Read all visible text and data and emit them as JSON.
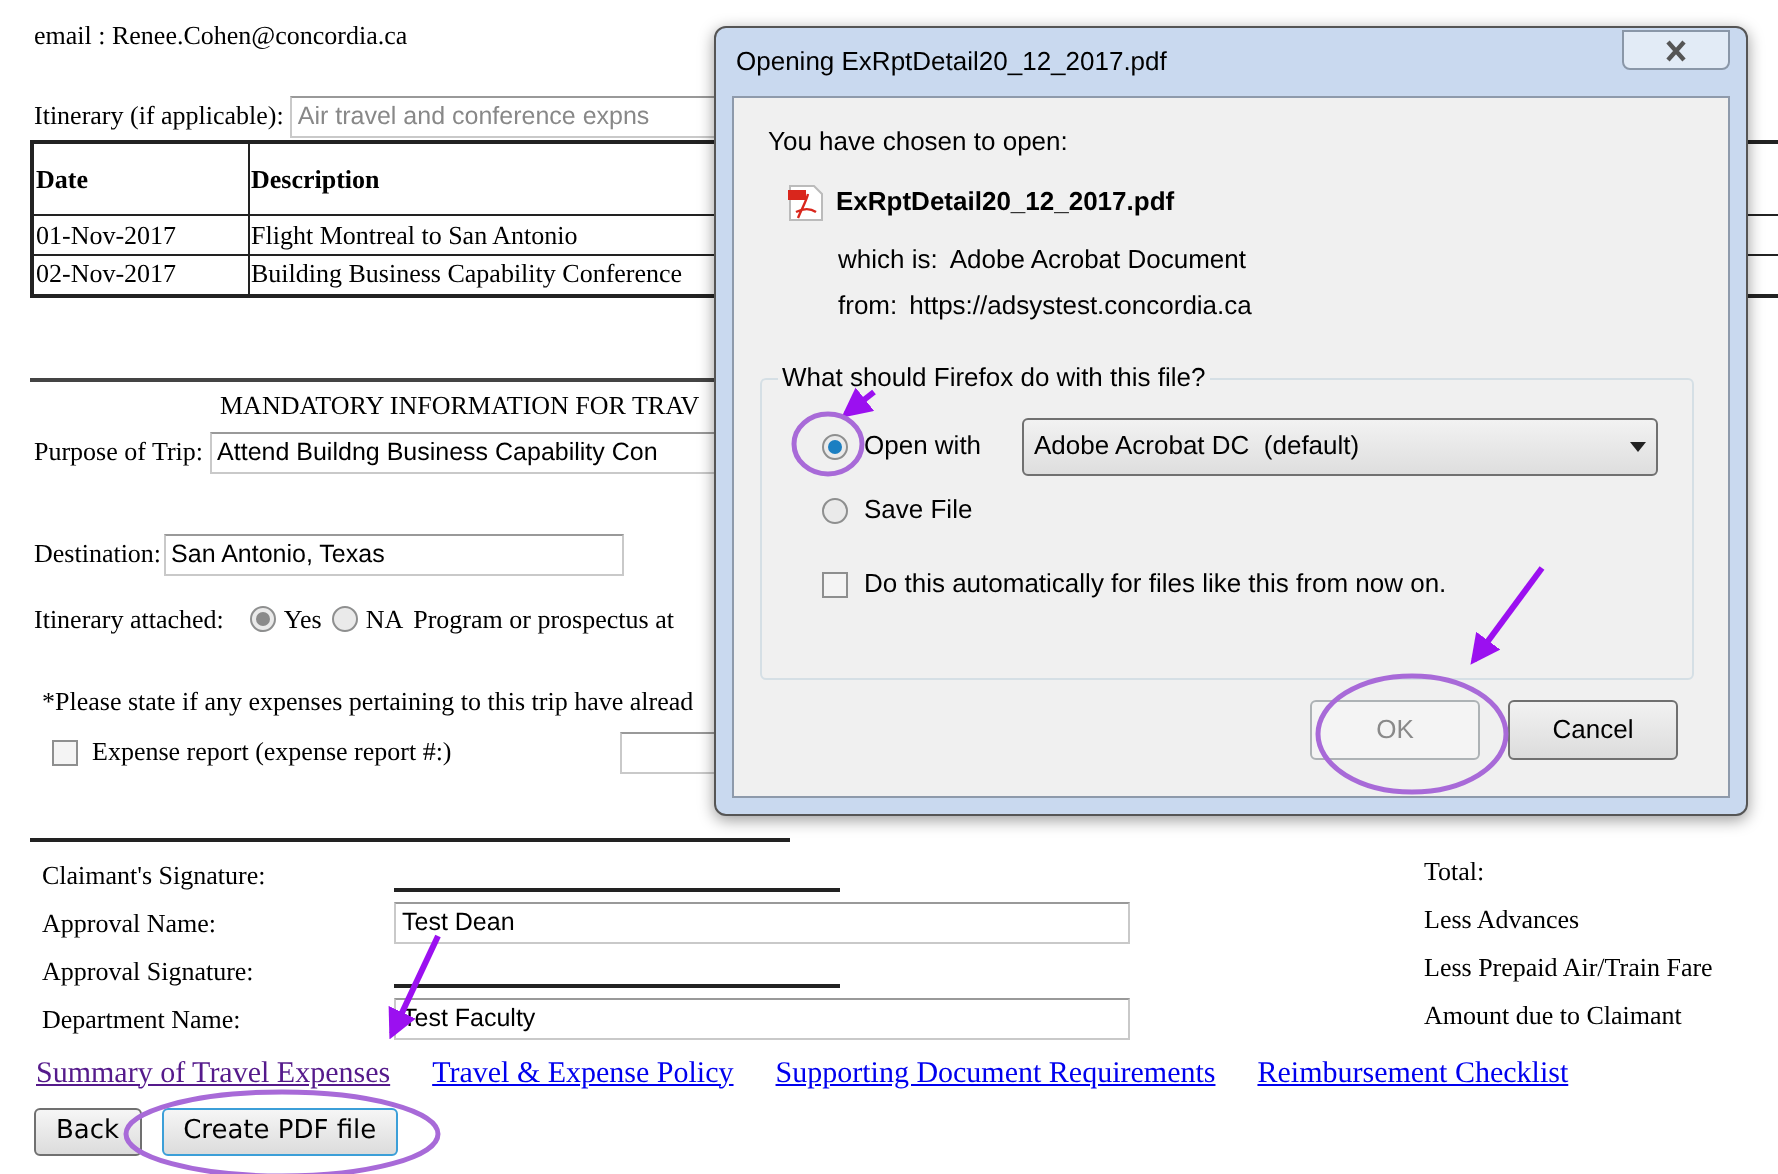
{
  "page": {
    "email": "email : Renee.Cohen@concordia.ca",
    "itinerary": {
      "label": "Itinerary (if applicable):",
      "value": "Air travel and conference expns",
      "disabled": true
    },
    "table": {
      "columns": [
        "Date",
        "Description"
      ],
      "rows": [
        [
          "01-Nov-2017",
          "Flight Montreal to San Antonio"
        ],
        [
          "02-Nov-2017",
          "Building Business Capability Conference"
        ]
      ]
    },
    "section_heading": "MANDATORY INFORMATION FOR TRAV",
    "purpose": {
      "label": "Purpose of Trip:",
      "value": "Attend Buildng Business Capability Con"
    },
    "destination": {
      "label": "Destination:",
      "value": "San Antonio, Texas"
    },
    "itinerary_attached": {
      "label": "Itinerary attached:",
      "options": [
        {
          "label": "Yes",
          "selected": true
        },
        {
          "label": "NA",
          "selected": false
        }
      ],
      "trailing": "Program or prospectus at"
    },
    "expenses_note": "*Please state if any expenses pertaining to this trip have alread",
    "expense_report": {
      "label": "Expense report (expense report #:)",
      "checked": false
    },
    "signatures": [
      {
        "kind": "line",
        "label": "Claimant's Signature:"
      },
      {
        "kind": "field",
        "label": "Approval Name:",
        "value": "Test Dean"
      },
      {
        "kind": "line",
        "label": "Approval Signature:"
      },
      {
        "kind": "field",
        "label": "Department Name:",
        "value": "Test Faculty"
      }
    ],
    "totals": [
      "Total:",
      "Less Advances",
      "Less Prepaid Air/Train Fare",
      "Amount due to Claimant"
    ],
    "links": [
      {
        "label": "Summary of Travel Expenses",
        "visited": true
      },
      {
        "label": "Travel & Expense Policy",
        "visited": false
      },
      {
        "label": "Supporting Document Requirements",
        "visited": false
      },
      {
        "label": "Reimbursement Checklist",
        "visited": false
      }
    ],
    "buttons": [
      {
        "label": "Back",
        "focused": false
      },
      {
        "label": "Create PDF file",
        "focused": true
      }
    ]
  },
  "dialog": {
    "title": "Opening ExRptDetail20_12_2017.pdf",
    "intro": "You have chosen to open:",
    "filename": "ExRptDetail20_12_2017.pdf",
    "details": [
      {
        "label": "which is:",
        "value": "Adobe Acrobat Document"
      },
      {
        "label": "from:",
        "value": "https://adsystest.concordia.ca"
      }
    ],
    "question": "What should Firefox do with this file?",
    "options": [
      {
        "label": "Open with",
        "selected": true
      },
      {
        "label": "Save File",
        "selected": false
      }
    ],
    "application": "Adobe Acrobat DC  (default)",
    "remember": {
      "label": "Do this automatically for files like this from now on.",
      "checked": false
    },
    "buttons": [
      {
        "label": "OK",
        "disabled": true
      },
      {
        "label": "Cancel",
        "disabled": false
      }
    ]
  }
}
